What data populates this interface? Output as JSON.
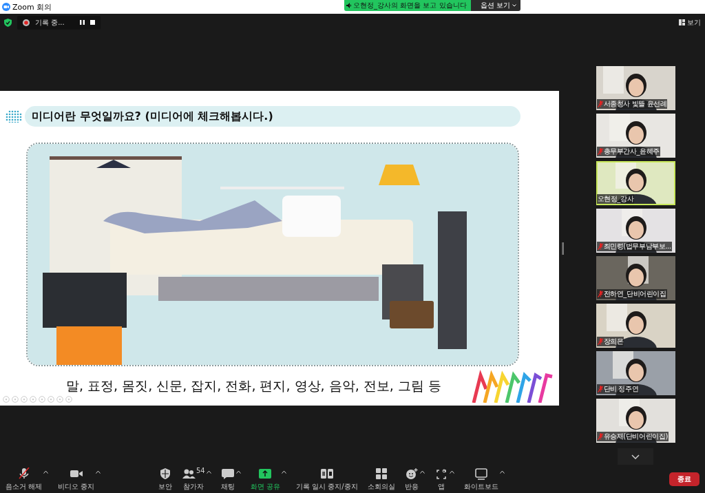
{
  "window": {
    "title": "Zoom 회의"
  },
  "share_banner": {
    "text": "오현정_강사의 화면을 보고 있습니다",
    "options": "옵션 보기"
  },
  "recording": {
    "label": "기록 중..."
  },
  "view_button": {
    "label": "보기"
  },
  "slide": {
    "title": "미디어란 무엇일까요? (미디어에 체크해봅시다.)",
    "caption": "말, 표정, 몸짓, 신문, 잡지, 전화, 편지, 영상, 음악, 전보, 그림 등"
  },
  "participants": [
    {
      "name": "서종청사 빛뜰 윤선례",
      "muted": true,
      "speaking": false
    },
    {
      "name": "총무부간사_윤혜주",
      "muted": true,
      "speaking": false
    },
    {
      "name": "오현정_강사",
      "muted": false,
      "speaking": true
    },
    {
      "name": "최민령(법무부남부보...",
      "muted": true,
      "speaking": false
    },
    {
      "name": "전하연_단비어린이집",
      "muted": true,
      "speaking": false
    },
    {
      "name": "장희은",
      "muted": true,
      "speaking": false
    },
    {
      "name": "단비 정주연",
      "muted": true,
      "speaking": false
    },
    {
      "name": "유승재(단비어린이집)",
      "muted": true,
      "speaking": false
    }
  ],
  "toolbar": [
    {
      "kind": "mic",
      "label": "음소거 해제",
      "caret": true,
      "muted": true
    },
    {
      "kind": "video",
      "label": "비디오 중지",
      "caret": true
    },
    {
      "kind": "security",
      "label": "보안",
      "caret": false
    },
    {
      "kind": "participants",
      "label": "참가자",
      "caret": true,
      "count": "54"
    },
    {
      "kind": "chat",
      "label": "채팅",
      "caret": true
    },
    {
      "kind": "share",
      "label": "화면 공유",
      "caret": true
    },
    {
      "kind": "record",
      "label": "기록 일시 중지/중지",
      "caret": false
    },
    {
      "kind": "rooms",
      "label": "소회의실",
      "caret": false
    },
    {
      "kind": "reactions",
      "label": "반응",
      "caret": true
    },
    {
      "kind": "apps",
      "label": "앱",
      "caret": true
    },
    {
      "kind": "whiteboard",
      "label": "화이트보드",
      "caret": true
    }
  ],
  "end_button": {
    "label": "종료"
  }
}
